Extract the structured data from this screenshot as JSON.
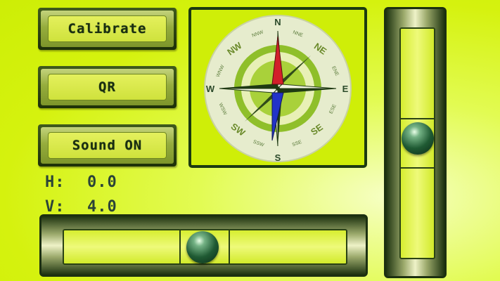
{
  "buttons": {
    "calibrate": "Calibrate",
    "qr": "QR",
    "sound": "Sound ON"
  },
  "readouts": {
    "h_label": "H:",
    "h_value": "0.0",
    "v_label": "V:",
    "v_value": "4.0"
  },
  "compass": {
    "north": "N",
    "south": "S",
    "east": "E",
    "west": "W",
    "ne": "NE",
    "nw": "NW",
    "se": "SE",
    "sw": "SW",
    "nne": "NNE",
    "nnw": "NNW",
    "ene": "ENE",
    "ese": "ESE",
    "sse": "SSE",
    "ssw": "SSW",
    "wsw": "WSW",
    "wnw": "WNW",
    "north_needle_color": "#d21f2a",
    "south_needle_color": "#2233c8"
  },
  "colors": {
    "background": "#d5f20e",
    "frame": "#1b3a10",
    "button_text": "#1a2e10"
  }
}
